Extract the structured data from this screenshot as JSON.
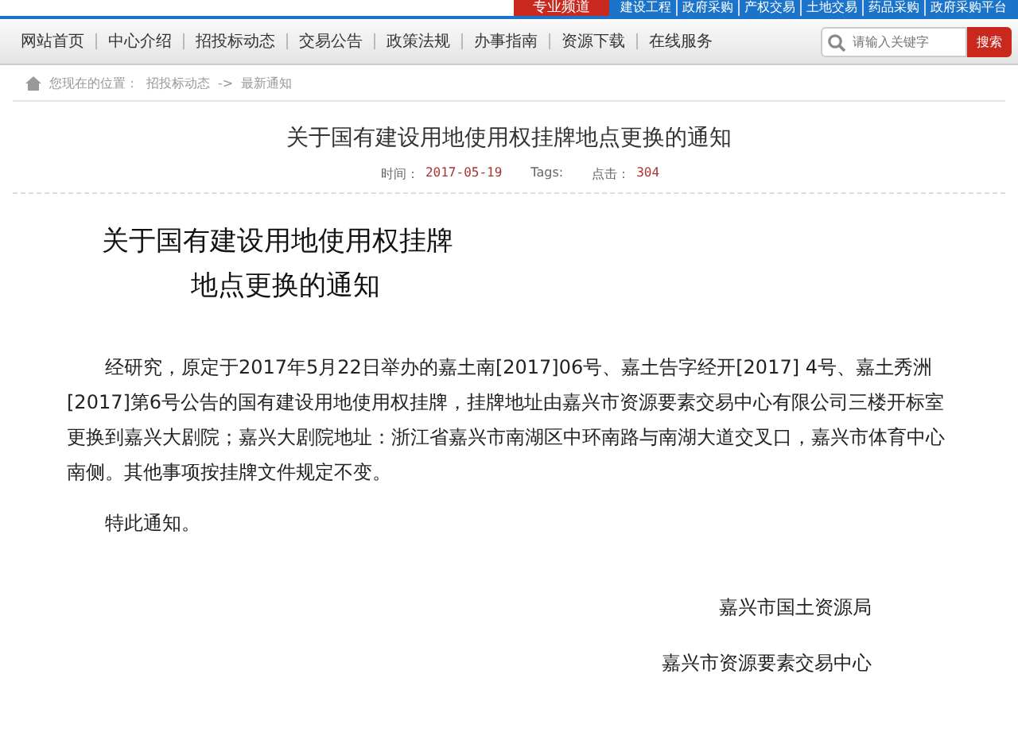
{
  "top_bar": {
    "channel": "专业频道",
    "links": [
      "建设工程",
      "政府采购",
      "产权交易",
      "土地交易",
      "药品采购",
      "政府采购平台"
    ]
  },
  "nav": {
    "items": [
      {
        "label": "网站首页",
        "selected": false
      },
      {
        "label": "中心介绍",
        "selected": false
      },
      {
        "label": "招投标动态",
        "selected": false
      },
      {
        "label": "交易公告",
        "selected": false
      },
      {
        "label": "政策法规",
        "selected": false
      },
      {
        "label": "办事指南",
        "selected": false
      },
      {
        "label": "资源下载",
        "selected": false
      },
      {
        "label": "在线服务",
        "selected": false
      }
    ],
    "search": {
      "placeholder": "请输入关键字",
      "button": "搜索"
    }
  },
  "breadcrumb": {
    "prefix": "您现在的位置：",
    "items": [
      "招投标动态",
      "最新通知"
    ],
    "separator": "->"
  },
  "article": {
    "title": "关于国有建设用地使用权挂牌地点更换的通知",
    "meta": [
      {
        "label": "时间：",
        "value": "2017-05-19"
      },
      {
        "label": "Tags:"
      },
      {
        "label": "点击：",
        "value": "304"
      }
    ],
    "heading": [
      "关于国有建设用地使用权挂牌",
      "地点更换的通知"
    ],
    "paragraphs": [
      "经研究，原定于2017年5月22日举办的嘉土南[2017]06号、嘉土告字经开[2017] 4号、嘉土秀洲[2017]第6号公告的国有建设用地使用权挂牌，挂牌地址由嘉兴市资源要素交易中心有限公司三楼开标室更换到嘉兴大剧院；嘉兴大剧院地址：浙江省嘉兴市南湖区中环南路与南湖大道交叉口，嘉兴市体育中心南侧。其他事项按挂牌文件规定不变。",
      "特此通知。"
    ],
    "signatures": [
      "嘉兴市国土资源局",
      "嘉兴市资源要素交易中心"
    ]
  }
}
